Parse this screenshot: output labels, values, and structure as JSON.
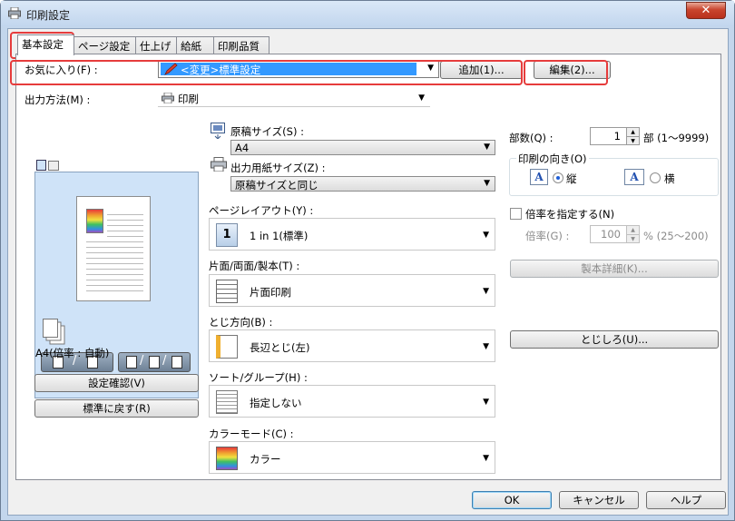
{
  "window": {
    "title": "印刷設定",
    "close_label": "✕"
  },
  "tabs": [
    {
      "label": "基本設定",
      "active": true
    },
    {
      "label": "ページ設定"
    },
    {
      "label": "仕上げ"
    },
    {
      "label": "給紙"
    },
    {
      "label": "印刷品質"
    }
  ],
  "favorites": {
    "label": "お気に入り(F) :",
    "value": "<変更>標準設定",
    "add_label": "追加(1)...",
    "edit_label": "編集(2)..."
  },
  "output": {
    "label": "出力方法(M) :",
    "value": "印刷"
  },
  "preview": {
    "status": "A4(倍率 : 自動)",
    "confirm_label": "設定確認(V)",
    "reset_label": "標準に戻す(R)"
  },
  "original_size": {
    "label": "原稿サイズ(S) :",
    "value": "A4"
  },
  "paper_size": {
    "label": "出力用紙サイズ(Z) :",
    "value": "原稿サイズと同じ"
  },
  "page_layout": {
    "label": "ページレイアウト(Y) :",
    "value": "1 in 1(標準)",
    "icon_text": "1"
  },
  "duplex": {
    "label": "片面/両面/製本(T) :",
    "value": "片面印刷"
  },
  "binding": {
    "label": "とじ方向(B) :",
    "value": "長辺とじ(左)"
  },
  "sort": {
    "label": "ソート/グループ(H) :",
    "value": "指定しない"
  },
  "color_mode": {
    "label": "カラーモード(C) :",
    "value": "カラー"
  },
  "copies": {
    "label": "部数(Q) :",
    "value": "1",
    "unit": "部 (1〜9999)"
  },
  "orientation": {
    "label": "印刷の向き(O)",
    "portrait": "縦",
    "landscape": "横",
    "selected": "portrait",
    "icon_letter": "A"
  },
  "scale": {
    "check_label": "倍率を指定する(N)",
    "label": "倍率(G) :",
    "value": "100",
    "range": "% (25〜200)",
    "checked": false
  },
  "booklet_label": "製本詳細(K)...",
  "gutter_label": "とじしろ(U)...",
  "footer": {
    "ok": "OK",
    "cancel": "キャンセル",
    "help": "ヘルプ"
  },
  "colors": {
    "highlight": "#e63c3c",
    "preview_bg": "#cfe3f8",
    "selection": "#3399ff"
  }
}
